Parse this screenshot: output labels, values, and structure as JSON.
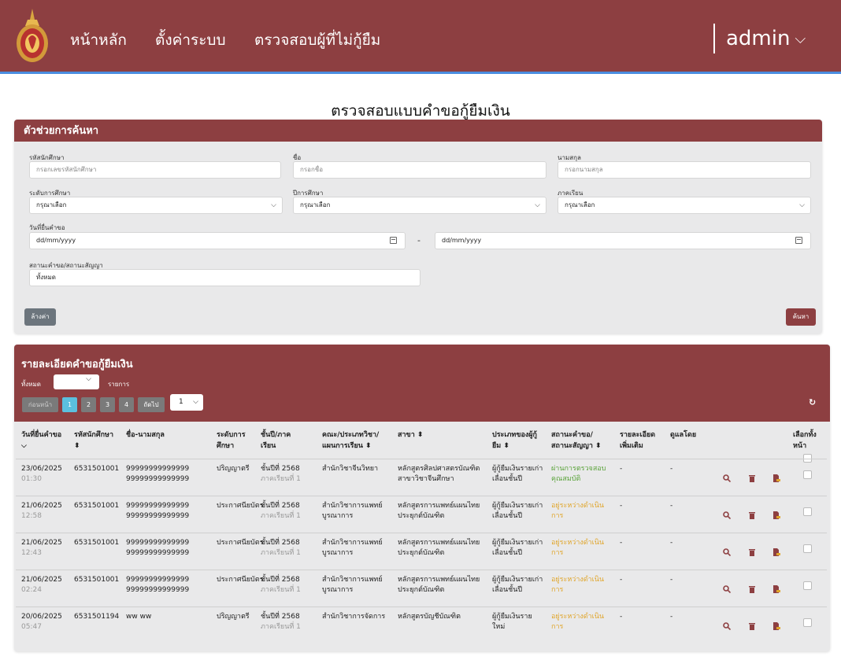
{
  "nav": {
    "home": "หน้าหลัก",
    "settings": "ตั้งค่าระบบ",
    "check": "ตรวจสอบผู้ที่ไม่กู้ยืม",
    "user": "admin"
  },
  "page_title": "ตรวจสอบแบบคำขอกู้ยืมเงิน",
  "search": {
    "title": "ตัวช่วยการค้นหา",
    "student_id_label": "รหัสนักศึกษา",
    "student_id_placeholder": "กรอกเลขรหัสนักศึกษา",
    "first_name_label": "ชื่อ",
    "first_name_placeholder": "กรอกชื่อ",
    "last_name_label": "นามสกุล",
    "last_name_placeholder": "กรอกนามสกุล",
    "level_label": "ระดับการศึกษา",
    "level_value": "กรุณาเลือก",
    "year_label": "ปีการศึกษา",
    "year_value": "กรุณาเลือก",
    "term_label": "ภาคเรียน",
    "term_value": "กรุณาเลือก",
    "date_label": "วันที่ยื่นคำขอ",
    "date_from": "dd/mm/yyyy",
    "date_sep": "-",
    "date_to": "dd/mm/yyyy",
    "status_label": "สถานะคำขอ/สถานะสัญญา",
    "status_value": "ทั้งหมด",
    "clear_label": "ล้างค่า",
    "search_label": "ค้นหา"
  },
  "list": {
    "title": "รายละเอียดคำขอกู้ยืมเงิน",
    "all_label": "ทั้งหมด",
    "items_label": "รายการ",
    "prev_label": "ก่อนหน้า",
    "pages": [
      "1",
      "2",
      "3",
      "4"
    ],
    "next_label": "ถัดไป",
    "page_select": "1",
    "headers": {
      "date": "วันที่ยื่นคำขอ",
      "sid": "รหัสนักศึกษา",
      "name": "ชื่อ-นามสกุล",
      "level1": "ระดับการ",
      "level2": "ศึกษา",
      "year1": "ชั้นปี/ภาค",
      "year2": "เรียน",
      "faculty1": "คณะ/ประเภทวิชา/",
      "faculty2": "แผนการเรียน",
      "major": "สาขา",
      "type1": "ประเภทของผู้กู้",
      "type2": "ยืม",
      "status1": "สถานะคำขอ/",
      "status2": "สถานะสัญญา",
      "detail1": "รายละเอียด",
      "detail2": "เพิ่มเติม",
      "owner": "ดูแลโดย",
      "selall1": "เลือกทั้ง",
      "selall2": "หน้า"
    },
    "rows": [
      {
        "date": "23/06/2025",
        "time": "01:30",
        "sid": "6531501001",
        "name1": "99999999999999",
        "name2": "99999999999999",
        "level": "ปริญญาตรี",
        "year": "ชั้นปีที่ 2568",
        "term": "ภาคเรียนที่ 1",
        "fac1": "สำนักวิชาจีนวิทยา",
        "fac2": "",
        "major1": "หลักสูตรศิลปศาสตรบัณฑิต",
        "major2": "สาขาวิชาจีนศึกษา",
        "type1": "ผู้กู้ยืมเงินรายเก่า",
        "type2": "เลื่อนชั้นปี",
        "status1": "ผ่านการตรวจสอบ",
        "status2": "คุณสมบัติ",
        "status_color": "#5aa33a",
        "detail": "-",
        "owner": "-"
      },
      {
        "date": "21/06/2025",
        "time": "12:58",
        "sid": "6531501001",
        "name1": "99999999999999",
        "name2": "99999999999999",
        "level": "ประกาศนียบัตร",
        "year": "ชั้นปีที่ 2568",
        "term": "ภาคเรียนที่ 1",
        "fac1": "สำนักวิชาการแพทย์",
        "fac2": "บูรณาการ",
        "major1": "หลักสูตรการแพทย์แผนไทย",
        "major2": "ประยุกต์บัณฑิต",
        "type1": "ผู้กู้ยืมเงินรายเก่า",
        "type2": "เลื่อนชั้นปี",
        "status1": "อยู่ระหว่างดำเนิน",
        "status2": "การ",
        "status_color": "#e0a52a",
        "detail": "-",
        "owner": "-"
      },
      {
        "date": "21/06/2025",
        "time": "12:43",
        "sid": "6531501001",
        "name1": "99999999999999",
        "name2": "99999999999999",
        "level": "ประกาศนียบัตร",
        "year": "ชั้นปีที่ 2568",
        "term": "ภาคเรียนที่ 1",
        "fac1": "สำนักวิชาการแพทย์",
        "fac2": "บูรณาการ",
        "major1": "หลักสูตรการแพทย์แผนไทย",
        "major2": "ประยุกต์บัณฑิต",
        "type1": "ผู้กู้ยืมเงินรายเก่า",
        "type2": "เลื่อนชั้นปี",
        "status1": "อยู่ระหว่างดำเนิน",
        "status2": "การ",
        "status_color": "#e0a52a",
        "detail": "-",
        "owner": "-"
      },
      {
        "date": "21/06/2025",
        "time": "02:24",
        "sid": "6531501001",
        "name1": "99999999999999",
        "name2": "99999999999999",
        "level": "ประกาศนียบัตร",
        "year": "ชั้นปีที่ 2568",
        "term": "ภาคเรียนที่ 1",
        "fac1": "สำนักวิชาการแพทย์",
        "fac2": "บูรณาการ",
        "major1": "หลักสูตรการแพทย์แผนไทย",
        "major2": "ประยุกต์บัณฑิต",
        "type1": "ผู้กู้ยืมเงินรายเก่า",
        "type2": "เลื่อนชั้นปี",
        "status1": "อยู่ระหว่างดำเนิน",
        "status2": "การ",
        "status_color": "#e0a52a",
        "detail": "-",
        "owner": "-"
      },
      {
        "date": "20/06/2025",
        "time": "05:47",
        "sid": "6531501194",
        "name1": "ww ww",
        "name2": "",
        "level": "ปริญญาตรี",
        "year": "ชั้นปีที่ 2568",
        "term": "ภาคเรียนที่ 1",
        "fac1": "สำนักวิชาการจัดการ",
        "fac2": "",
        "major1": "หลักสูตรบัญชีบัณฑิต",
        "major2": "",
        "type1": "ผู้กู้ยืมเงินราย",
        "type2": "ใหม่",
        "status1": "อยู่ระหว่างดำเนิน",
        "status2": "การ",
        "status_color": "#e0a52a",
        "detail": "-",
        "owner": "-"
      }
    ]
  },
  "colors": {
    "brand": "#8d3f41",
    "accent": "#4a8de0",
    "page_active": "#5bc0de"
  },
  "icons": [
    "chevron-down-icon",
    "calendar-icon",
    "refresh-icon",
    "search-icon",
    "trash-icon",
    "document-icon",
    "sort-icon"
  ]
}
